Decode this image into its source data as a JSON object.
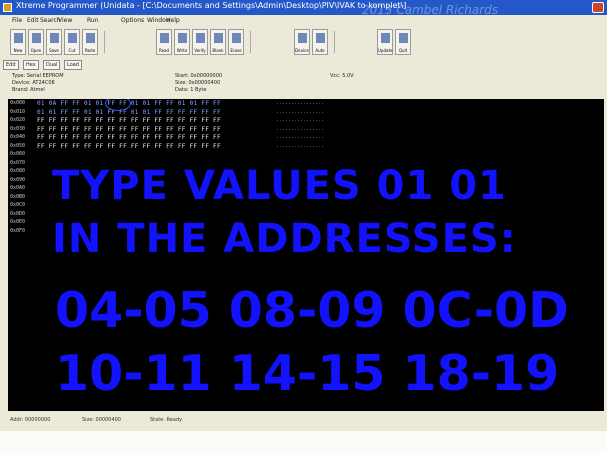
{
  "window": {
    "title": "Xtreme Programmer (Unidata - [C:\\Documents and Settings\\Admin\\Desktop\\PIV\\IVAK to komplet\\]",
    "title_watermark": "2013 Cambel Richards",
    "titlebar_color": "#2458c9"
  },
  "menubar": {
    "items": [
      "File",
      "Edit",
      "Search",
      "View",
      "Run",
      "Options",
      "Window",
      "Help"
    ]
  },
  "toolbar": {
    "groups": [
      [
        "New",
        "Open",
        "Save",
        "Cut",
        "Paste"
      ],
      [
        "Read",
        "Write",
        "Verify",
        "Blank",
        "Erase"
      ],
      [
        "Device",
        "Auto"
      ],
      [
        "Update",
        "Quit"
      ]
    ]
  },
  "tabs": [
    "Edit",
    "Hex",
    "Dual",
    "Load"
  ],
  "info": {
    "type": "Type: Serial EEPROM",
    "device": "Device: AT24C08",
    "brand": "Brand: Atmel",
    "start": "Start: 0x00000000",
    "size": "Size: 0x00000400",
    "data": "Data: 1 Byte",
    "vcc": "Vcc: 5.0V"
  },
  "hex": {
    "addresses": [
      "0x000",
      "0x010",
      "0x020",
      "0x030",
      "0x040",
      "0x050",
      "0x060",
      "0x070",
      "0x080",
      "0x090",
      "0x0A0",
      "0x0B0",
      "0x0C0",
      "0x0D0",
      "0x0E0",
      "0x0F0"
    ],
    "rows": [
      "01 0A FF FF 01 01 FF FF 01 01 FF FF 01 01 FF FF",
      "01 01 FF FF 01 01 FF FF 01 01 FF FF FF FF FF FF",
      "FF FF FF FF FF FF FF FF FF FF FF FF FF FF FF FF",
      "FF FF FF FF FF FF FF FF FF FF FF FF FF FF FF FF",
      "FF FF FF FF FF FF FF FF FF FF FF FF FF FF FF FF",
      "FF FF FF FF FF FF FF FF FF FF FF FF FF FF FF FF"
    ],
    "ascii": [
      "................",
      "................",
      "................",
      "................",
      "................",
      "................"
    ]
  },
  "overlay": {
    "line1": "TYPE VALUES 01 01",
    "line2": "IN THE ADDRESSES:",
    "line3": "04-05 08-09 0C-0D",
    "line4": "10-11 14-15 18-19",
    "color": "#1212ff"
  },
  "statusbar": {
    "addr": "Addr: 00000000",
    "size": "Size: 00000400",
    "state": "State: Ready"
  }
}
